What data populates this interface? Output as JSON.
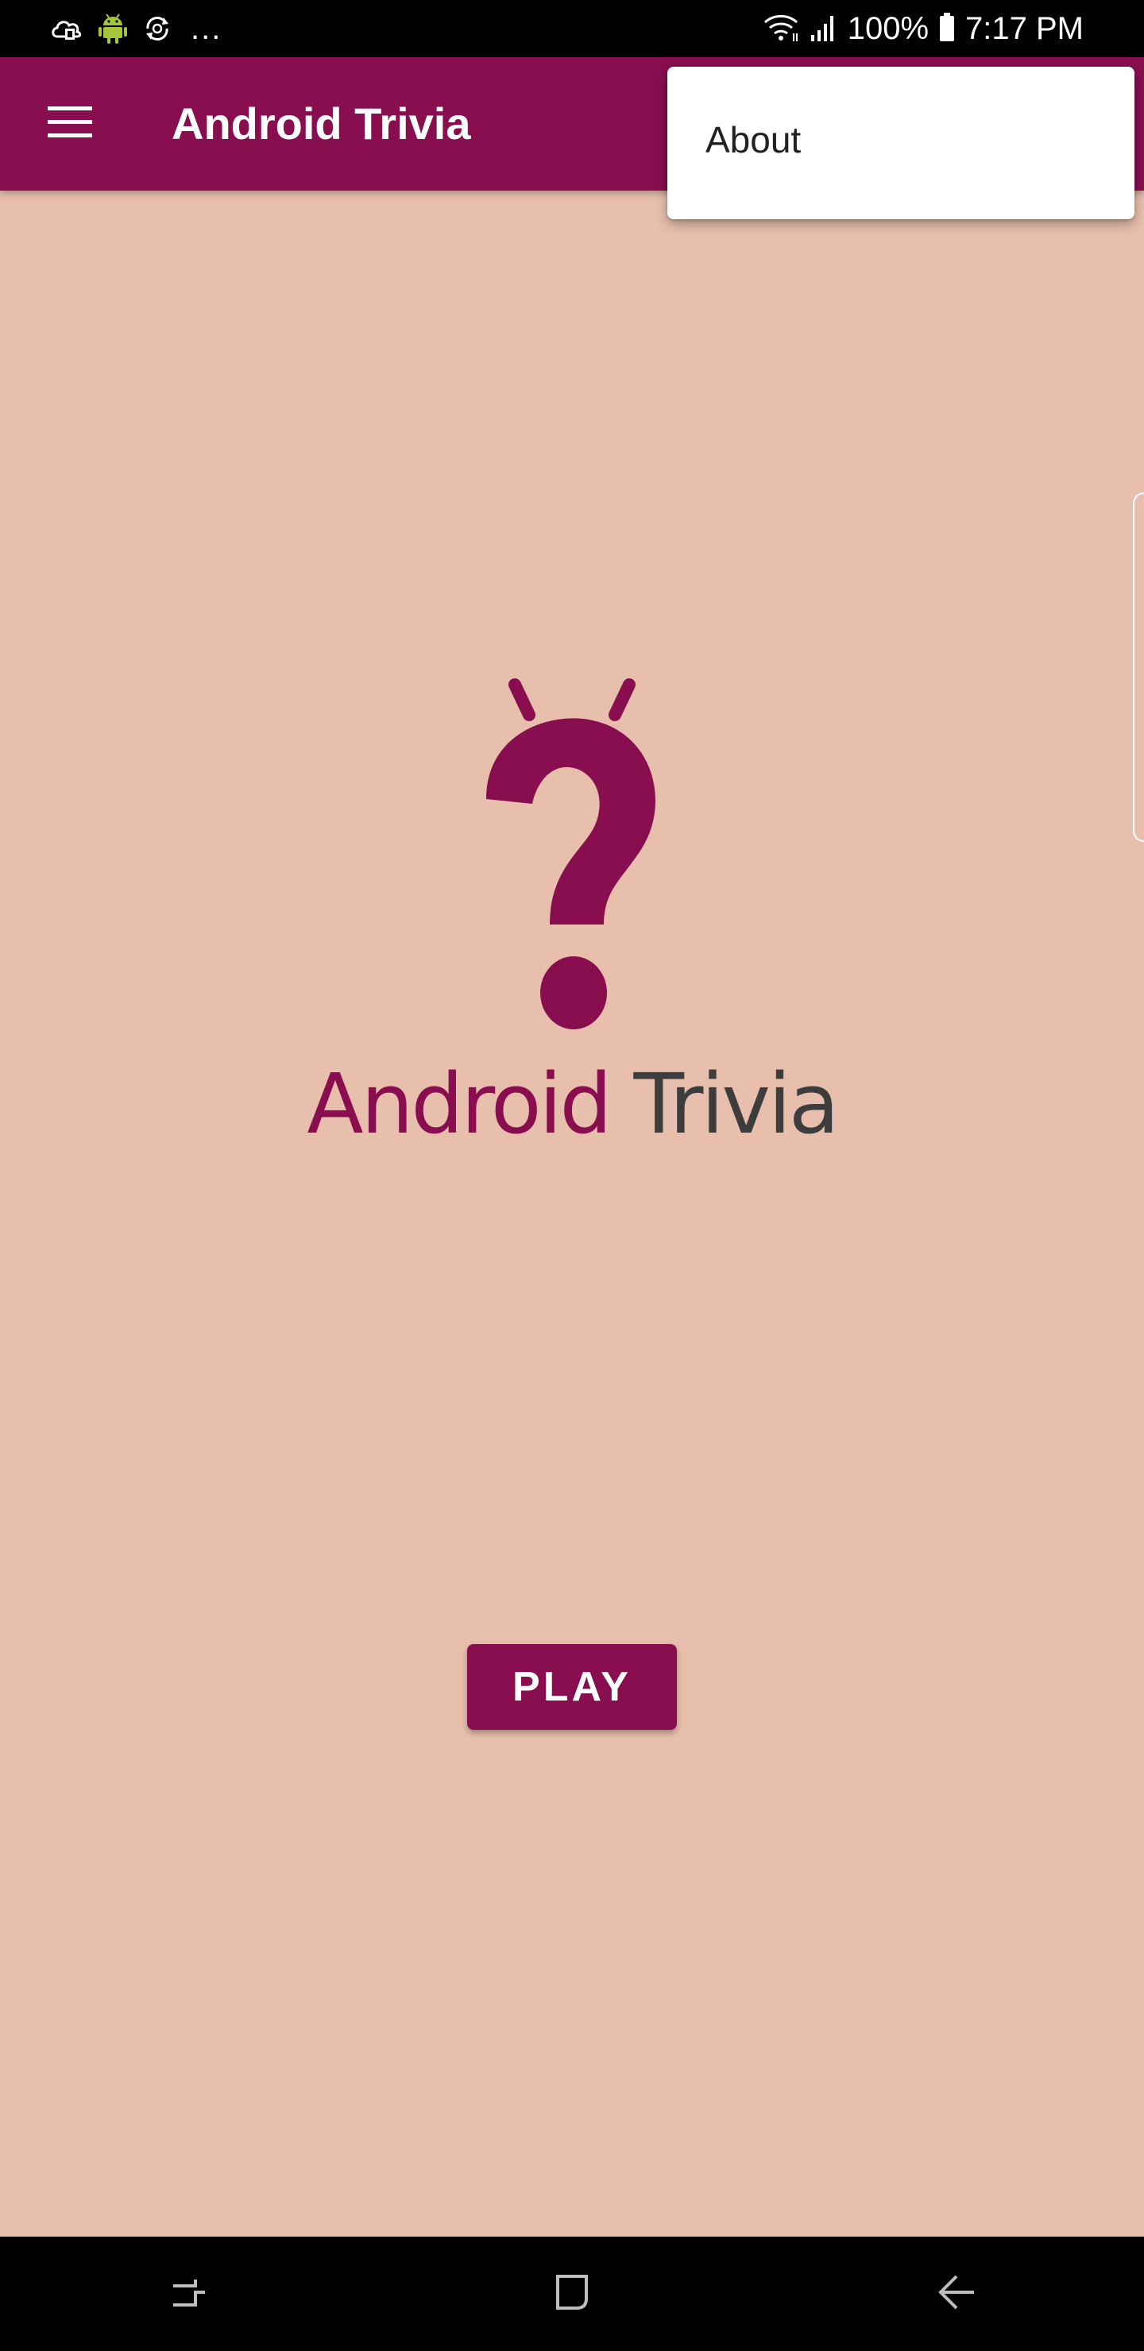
{
  "status_bar": {
    "battery": "100%",
    "time": "7:17 PM",
    "notification_icons": [
      "cloud-sync-icon",
      "android-icon",
      "sync-icon"
    ],
    "more": "..."
  },
  "app_bar": {
    "title": "Android Trivia",
    "menu_icon": "hamburger-menu-icon"
  },
  "overflow_menu": {
    "items": [
      {
        "label": "About"
      }
    ]
  },
  "main": {
    "logo_text_1": "Android",
    "logo_text_2": "Trivia",
    "play_label": "PLAY"
  },
  "navigation": {
    "buttons": [
      "recent-apps-icon",
      "home-icon",
      "back-icon"
    ]
  },
  "colors": {
    "primary": "#880E4F",
    "background": "#E8BFAD",
    "logo_dark": "#3D3D3D",
    "menu_background": "#FFFFFF"
  }
}
